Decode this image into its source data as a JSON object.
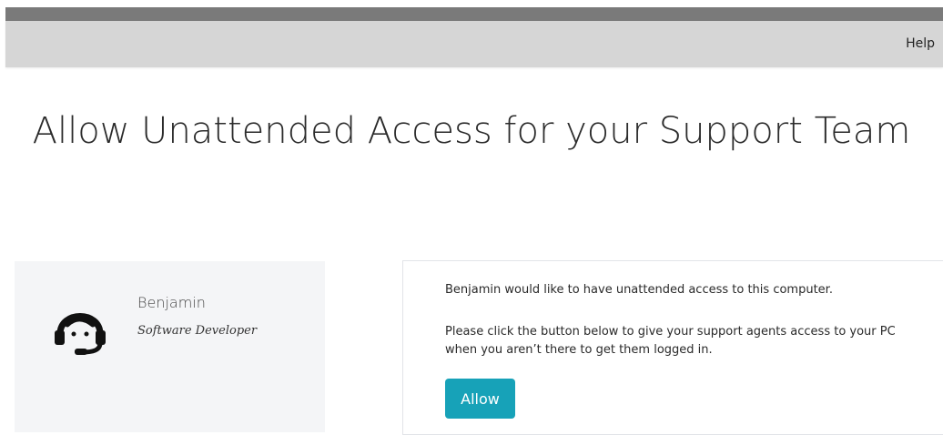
{
  "nav": {
    "help_label": "Help"
  },
  "page": {
    "title": "Allow Unattended Access for your Support Team"
  },
  "agent": {
    "name": "Benjamin",
    "role": "Software Developer",
    "avatar_icon": "headset-agent-icon"
  },
  "request": {
    "line1": "Benjamin would like to have unattended access to this computer.",
    "line2": "Please click the button below to give your support agents access to your PC when you aren’t there to get them logged in.",
    "allow_label": "Allow"
  },
  "colors": {
    "accent": "#17a2b8",
    "navbar": "#d6d6d6",
    "topbar": "#7a7a7a",
    "card_bg": "#f4f5f7"
  }
}
